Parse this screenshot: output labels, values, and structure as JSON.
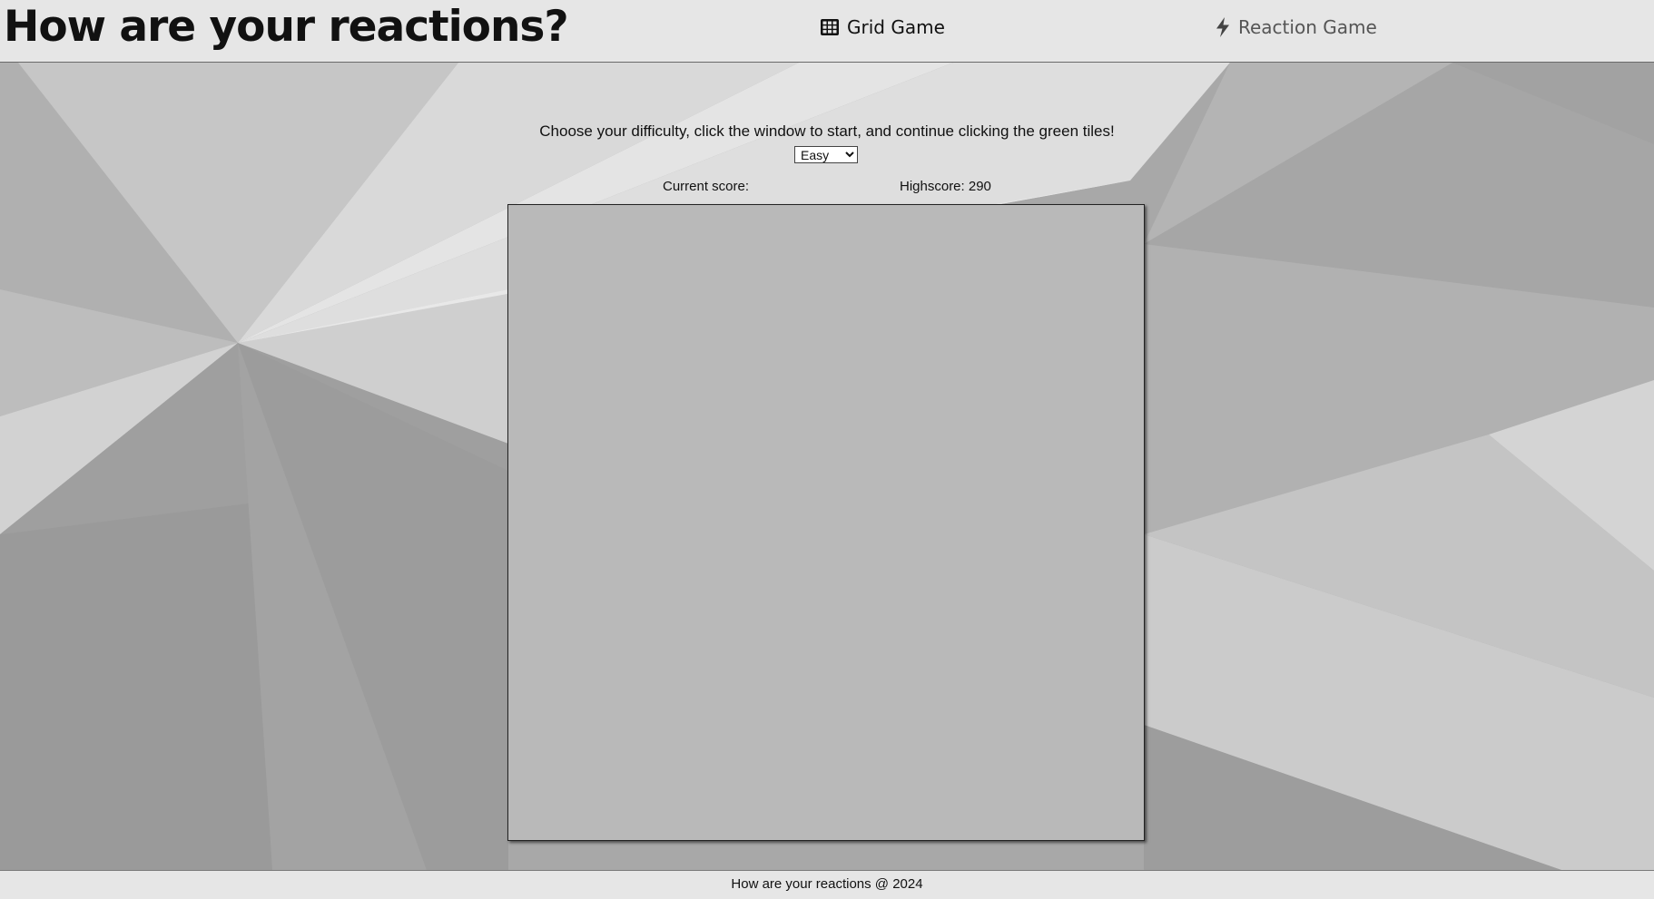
{
  "header": {
    "title": "How are your reactions?",
    "nav": [
      {
        "label": "Grid Game",
        "icon": "grid-icon"
      },
      {
        "label": "Reaction Game",
        "icon": "lightning-icon"
      }
    ]
  },
  "main": {
    "instructions": "Choose your difficulty, click the window to start, and continue clicking the green tiles!",
    "difficulty": {
      "selected": "Easy"
    },
    "score": {
      "current_label": "Current score:",
      "highscore_label": "Highscore: 290"
    }
  },
  "footer": {
    "text": "How are your reactions @ 2024"
  },
  "colors": {
    "header_bg": "#e6e6e6",
    "board_bg": "#b9b9b9",
    "footer_bg": "#e6e6e6"
  }
}
